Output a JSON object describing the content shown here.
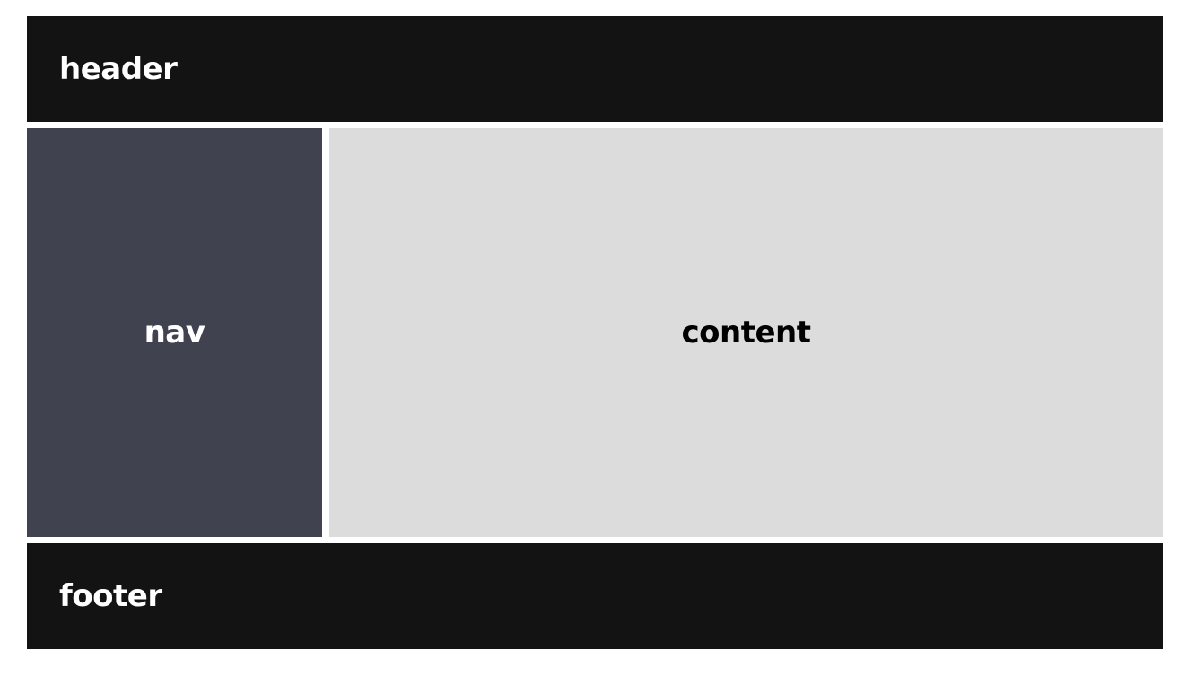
{
  "regions": {
    "header": {
      "label": "header",
      "background": "#131313",
      "text_color": "#ffffff"
    },
    "nav": {
      "label": "nav",
      "background": "#41424f",
      "text_color": "#ffffff"
    },
    "content": {
      "label": "content",
      "background": "#dcdcdc",
      "text_color": "#000000"
    },
    "footer": {
      "label": "footer",
      "background": "#131313",
      "text_color": "#ffffff"
    }
  },
  "page_background": "#ffffff"
}
